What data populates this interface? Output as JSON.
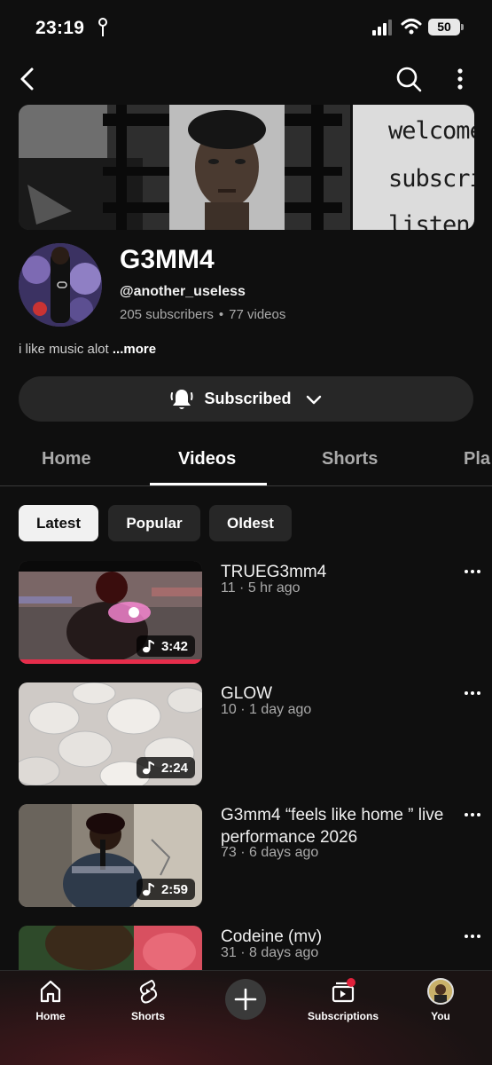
{
  "status_bar": {
    "time": "23:19",
    "battery": "50"
  },
  "channel": {
    "name": "G3MM4",
    "handle": "@another_useless",
    "subscribers": "205 subscribers",
    "separator": "•",
    "video_count": "77 videos",
    "description": "i like music alot",
    "more_label": "...more",
    "subscribe_label": "Subscribed"
  },
  "banner": {
    "sign_lines": [
      "welcome",
      "subscrib",
      "listen"
    ]
  },
  "tabs": [
    {
      "label": "Home",
      "active": false
    },
    {
      "label": "Videos",
      "active": true
    },
    {
      "label": "Shorts",
      "active": false
    },
    {
      "label": "Pla",
      "active": false
    }
  ],
  "chips": [
    {
      "label": "Latest",
      "active": true
    },
    {
      "label": "Popular",
      "active": false
    },
    {
      "label": "Oldest",
      "active": false
    }
  ],
  "videos": [
    {
      "title": "TRUEG3mm4",
      "meta": "11 · 5 hr ago",
      "duration": "3:42",
      "watched_progress": 1.0
    },
    {
      "title": "GLOW",
      "meta": "10 · 1 day ago",
      "duration": "2:24"
    },
    {
      "title": "G3mm4 “feels like home ” live performance 2026",
      "meta": "73 · 6 days ago",
      "duration": "2:59"
    },
    {
      "title": "Codeine (mv)",
      "meta": "31 · 8 days ago",
      "duration": ""
    }
  ],
  "bottom_nav": {
    "home": "Home",
    "shorts": "Shorts",
    "subscriptions": "Subscriptions",
    "you": "You"
  },
  "colors": {
    "background": "#0f0f0f",
    "progress": "#e62d4b",
    "notification_dot": "#e0213b"
  }
}
